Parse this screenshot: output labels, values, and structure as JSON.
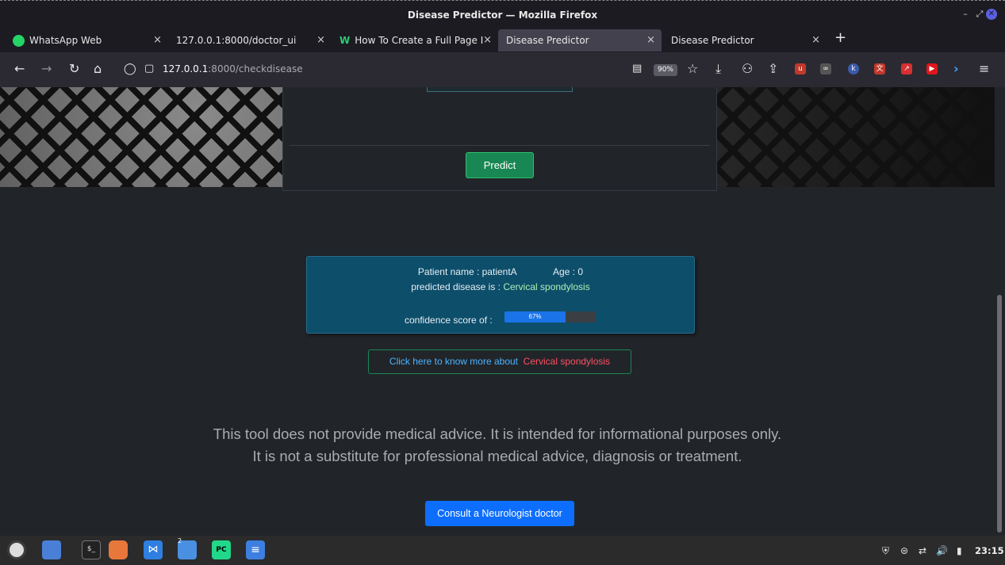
{
  "window": {
    "title": "Disease Predictor — Mozilla Firefox"
  },
  "tabs": [
    {
      "label": "WhatsApp Web"
    },
    {
      "label": "127.0.0.1:8000/doctor_ui"
    },
    {
      "label": "How To Create a Full Page I"
    },
    {
      "label": "Disease Predictor"
    },
    {
      "label": "Disease Predictor"
    }
  ],
  "navbar": {
    "url_host": "127.0.0.1",
    "url_path": ":8000/checkdisease",
    "zoom": "90%"
  },
  "form": {
    "predict_label": "Predict"
  },
  "result": {
    "patient_label": "Patient name : patientA",
    "age_label": "Age : 0",
    "predicted_prefix": "predicted disease is :",
    "disease": "Cervical spondylosis",
    "confidence_label": "confidence score of :",
    "confidence_text": "67%",
    "confidence_value": 0.67
  },
  "more_info": {
    "prefix": "Click here to know more about",
    "disease": "Cervical spondylosis"
  },
  "disclaimer": {
    "line1": "This tool does not provide medical advice. It is intended for informational purposes only.",
    "line2": "It is not a substitute for professional medical advice, diagnosis or treatment."
  },
  "consult": {
    "label": "Consult a Neurologist doctor"
  },
  "taskbar": {
    "clock": "23:15",
    "badge": "2"
  },
  "colors": {
    "result_bg": "#0d4e6b",
    "predict_green": "#198754",
    "consult_blue": "#0d6efd",
    "link_blue": "#4db3ff",
    "link_red": "#ff4f64"
  }
}
